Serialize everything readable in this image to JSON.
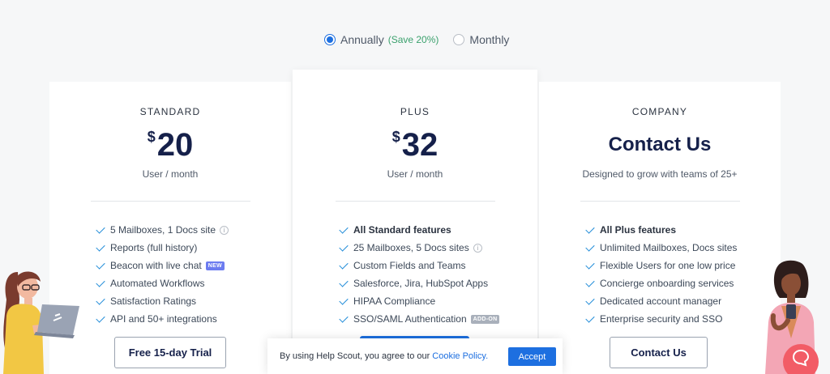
{
  "billing": {
    "annual_label": "Annually",
    "annual_save": "(Save 20%)",
    "monthly_label": "Monthly",
    "selected": "annual"
  },
  "plans": [
    {
      "tier": "STANDARD",
      "currency": "$",
      "price": "20",
      "sub": "User / month",
      "features": [
        {
          "text": "5 Mailboxes, 1 Docs site",
          "info": true
        },
        {
          "text": "Reports (full history)"
        },
        {
          "text": "Beacon with live chat",
          "tag": "NEW"
        },
        {
          "text": "Automated Workflows"
        },
        {
          "text": "Satisfaction Ratings"
        },
        {
          "text": "API and 50+ integrations"
        }
      ],
      "cta": "Free 15-day Trial"
    },
    {
      "tier": "PLUS",
      "currency": "$",
      "price": "32",
      "sub": "User / month",
      "features": [
        {
          "text": "All Standard features",
          "bold": true
        },
        {
          "text": "25 Mailboxes, 5 Docs sites",
          "info": true
        },
        {
          "text": "Custom Fields and Teams"
        },
        {
          "text": "Salesforce, Jira, HubSpot Apps"
        },
        {
          "text": "HIPAA Compliance"
        },
        {
          "text": "SSO/SAML Authentication",
          "tag": "ADD-ON"
        }
      ],
      "cta": ""
    },
    {
      "tier": "COMPANY",
      "title": "Contact Us",
      "sub": "Designed to grow with teams of 25+",
      "features": [
        {
          "text": "All Plus features",
          "bold": true
        },
        {
          "text": "Unlimited Mailboxes, Docs sites"
        },
        {
          "text": "Flexible Users for one low price"
        },
        {
          "text": "Concierge onboarding services"
        },
        {
          "text": "Dedicated account manager"
        },
        {
          "text": "Enterprise security and SSO"
        }
      ],
      "cta": "Contact Us"
    }
  ],
  "cookie": {
    "text": "By using Help Scout, you agree to our",
    "link": "Cookie Policy.",
    "accept": "Accept"
  },
  "colors": {
    "accent": "#1d6fe0",
    "save_green": "#3ba16d",
    "navy": "#15204a",
    "beacon": "#f25c66"
  }
}
